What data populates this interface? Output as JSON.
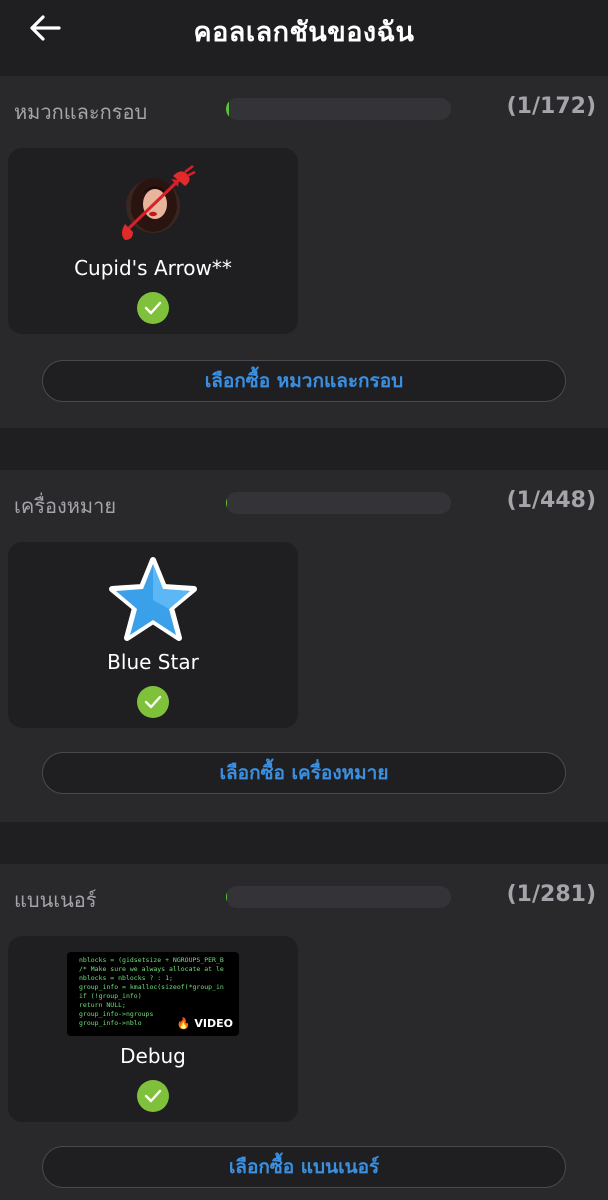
{
  "header": {
    "title": "คอลเลกชันของฉัน",
    "back_icon": "arrow-left-icon"
  },
  "sections": [
    {
      "title": "หมวกและกรอบ",
      "count": "(1/172)",
      "progress": 0.0058,
      "item": {
        "name": "Cupid's Arrow**",
        "icon": "cupid-avatar-frame",
        "owned": true
      },
      "buy_label": "เลือกซื้อ หมวกและกรอบ"
    },
    {
      "title": "เครื่องหมาย",
      "count": "(1/448)",
      "progress": 0.0022,
      "item": {
        "name": "Blue Star",
        "icon": "blue-star-icon",
        "owned": true
      },
      "buy_label": "เลือกซื้อ เครื่องหมาย"
    },
    {
      "title": "แบนเนอร์",
      "count": "(1/281)",
      "progress": 0.0036,
      "item": {
        "name": "Debug",
        "icon": "code-banner-video",
        "badge": "VIDEO",
        "owned": true,
        "code_lines": [
          "nblocks = (gidsetsize + NGROUPS_PER_B",
          "/* Make sure we always allocate at le",
          "nblocks = nblocks ? : 1;",
          "group_info = kmalloc(sizeof(*group_in",
          "if (!group_info)",
          "    return NULL;",
          "group_info->ngroups",
          "group_info->nblo"
        ]
      },
      "buy_label": "เลือกซื้อ แบนเนอร์"
    }
  ],
  "colors": {
    "background": "#1f1f21",
    "section": "#29292b",
    "accent_blue": "#3b8fe0",
    "check_green": "#7fc13b",
    "progress_green": "#5bc236"
  }
}
